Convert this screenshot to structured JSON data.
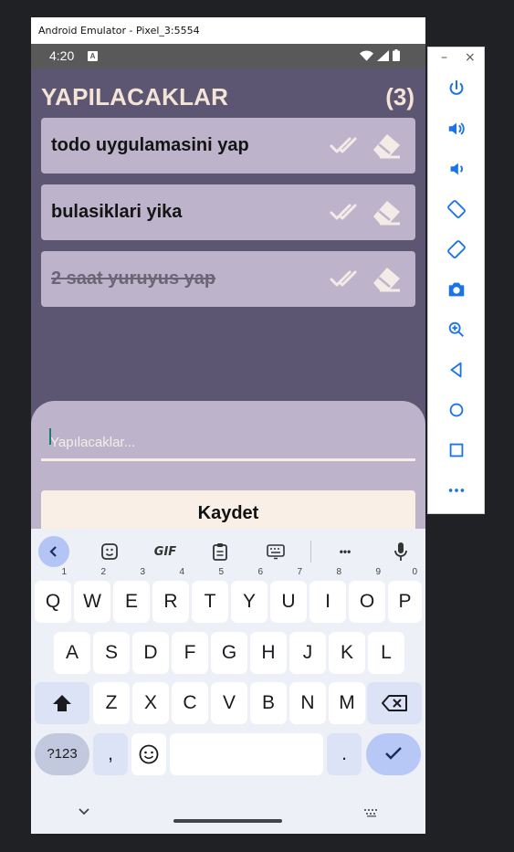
{
  "emulator": {
    "title": "Android Emulator - Pixel_3:5554",
    "window_controls": {
      "minimize": "–",
      "close": "×"
    },
    "side_buttons": [
      "power-icon",
      "volume-up-icon",
      "volume-down-icon",
      "rotate-left-icon",
      "rotate-right-icon",
      "camera-icon",
      "zoom-icon",
      "back-icon",
      "home-icon",
      "overview-icon",
      "more-icon"
    ]
  },
  "status_bar": {
    "time": "4:20",
    "notification_icon": "A"
  },
  "app": {
    "title": "YAPILACAKLAR",
    "count": "(3)",
    "todos": [
      {
        "text": "todo uygulamasini yap",
        "done": false
      },
      {
        "text": "bulasiklari yika",
        "done": false
      },
      {
        "text": "2 saat yuruyus yap",
        "done": true
      }
    ],
    "input_placeholder": "Yapılacaklar...",
    "save_label": "Kaydet"
  },
  "keyboard": {
    "toolbar": {
      "gif_label": "GIF",
      "more_label": "•••"
    },
    "row1": [
      {
        "k": "Q",
        "h": "1"
      },
      {
        "k": "W",
        "h": "2"
      },
      {
        "k": "E",
        "h": "3"
      },
      {
        "k": "R",
        "h": "4"
      },
      {
        "k": "T",
        "h": "5"
      },
      {
        "k": "Y",
        "h": "6"
      },
      {
        "k": "U",
        "h": "7"
      },
      {
        "k": "I",
        "h": "8"
      },
      {
        "k": "O",
        "h": "9"
      },
      {
        "k": "P",
        "h": "0"
      }
    ],
    "row2": [
      "A",
      "S",
      "D",
      "F",
      "G",
      "H",
      "J",
      "K",
      "L"
    ],
    "row3": [
      "Z",
      "X",
      "C",
      "V",
      "B",
      "N",
      "M"
    ],
    "sym_label": "?123",
    "comma_label": ",",
    "period_label": "."
  },
  "colors": {
    "background": "#5d5672",
    "card": "#bdb4cb",
    "title": "#f3e4d6",
    "button": "#f9efe6"
  }
}
